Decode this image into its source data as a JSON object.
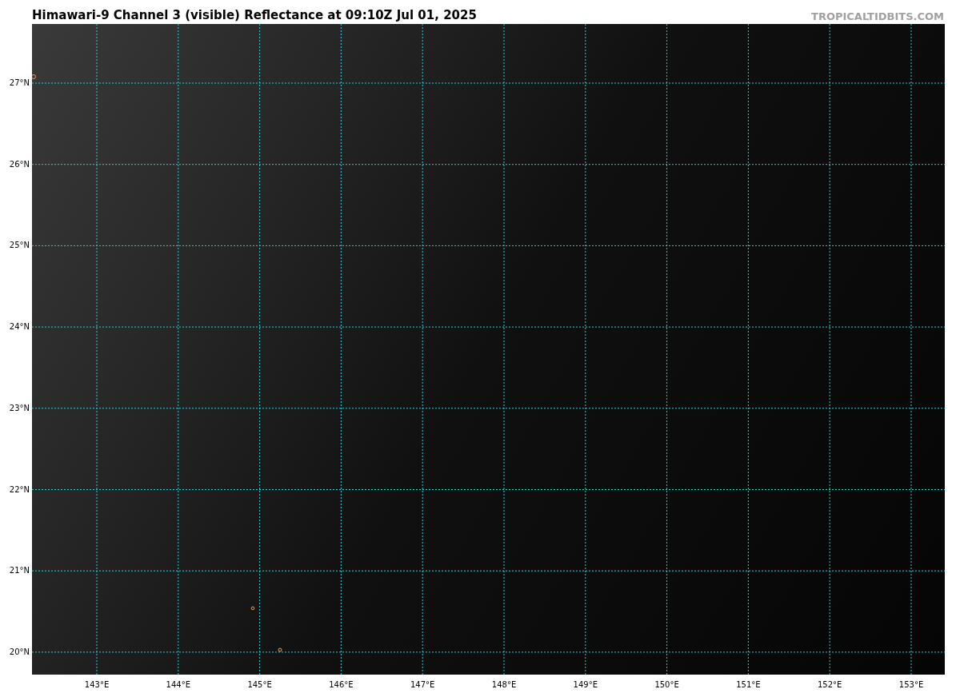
{
  "title": "Himawari-9 Channel 3 (visible) Reflectance at 09:10Z Jul 01, 2025",
  "credit": "TROPICALTIDBITS.COM",
  "map": {
    "lat_labels": [
      "27°N",
      "26°N",
      "25°N",
      "24°N",
      "23°N",
      "22°N",
      "21°N",
      "20°N"
    ],
    "lon_labels": [
      "143°E",
      "144°E",
      "145°E",
      "146°E",
      "147°E",
      "148°E",
      "149°E",
      "150°E",
      "151°E",
      "152°E",
      "153°E"
    ]
  }
}
